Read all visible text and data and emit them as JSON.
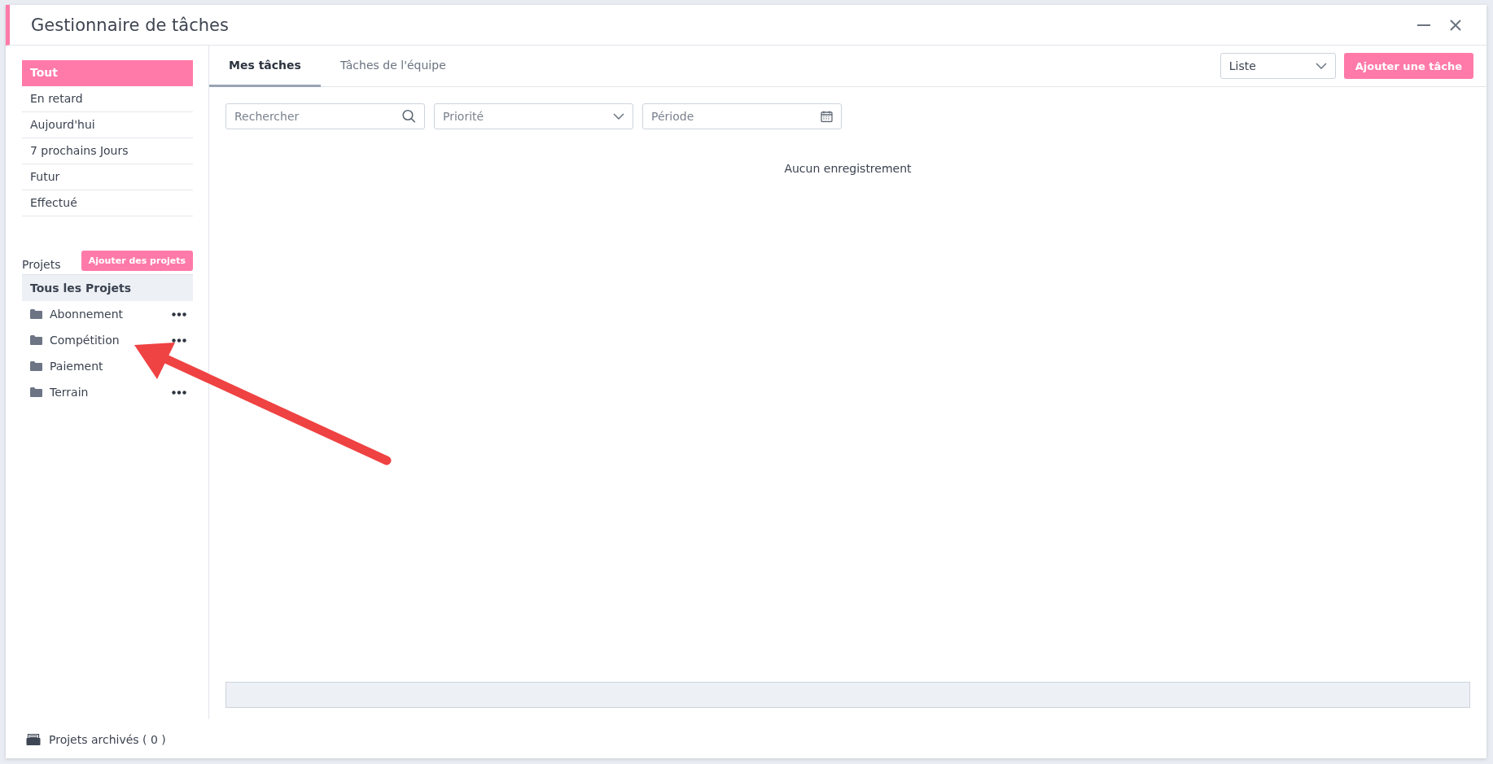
{
  "window": {
    "title": "Gestionnaire de tâches"
  },
  "filters": [
    {
      "label": "Tout",
      "selected": true
    },
    {
      "label": "En retard",
      "selected": false
    },
    {
      "label": "Aujourd'hui",
      "selected": false
    },
    {
      "label": "7 prochains Jours",
      "selected": false
    },
    {
      "label": "Futur",
      "selected": false
    },
    {
      "label": "Effectué",
      "selected": false
    }
  ],
  "projects": {
    "heading": "Projets",
    "add_button": "Ajouter des projets",
    "items": [
      {
        "label": "Tous les Projets",
        "kind": "all",
        "selected": true,
        "has_menu": false
      },
      {
        "label": "Abonnement",
        "kind": "folder",
        "selected": false,
        "has_menu": true
      },
      {
        "label": "Compétition",
        "kind": "folder",
        "selected": false,
        "has_menu": true
      },
      {
        "label": "Paiement",
        "kind": "folder",
        "selected": false,
        "has_menu": false
      },
      {
        "label": "Terrain",
        "kind": "folder",
        "selected": false,
        "has_menu": true
      }
    ]
  },
  "archived": "Projets archivés ( 0 )",
  "tabs": [
    {
      "label": "Mes tâches",
      "selected": true
    },
    {
      "label": "Tâches de l'équipe",
      "selected": false
    }
  ],
  "view_select": {
    "value": "Liste"
  },
  "add_task_button": "Ajouter une tâche",
  "search": {
    "placeholder": "Rechercher"
  },
  "priority": {
    "placeholder": "Priorité"
  },
  "period": {
    "placeholder": "Période"
  },
  "empty_message": "Aucun enregistrement"
}
